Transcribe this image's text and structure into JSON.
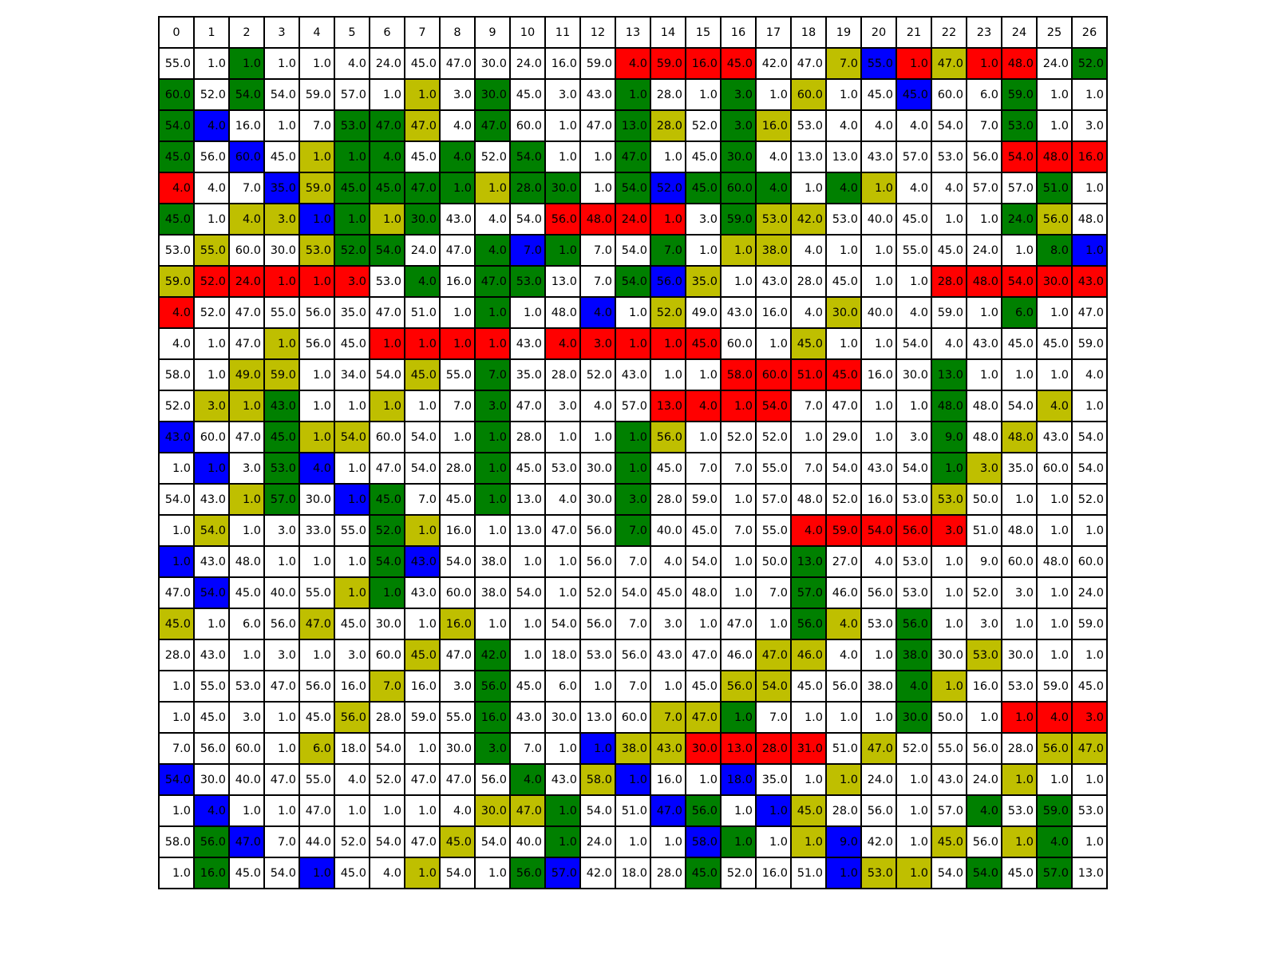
{
  "colors": {
    "w": "#ffffff",
    "g": "#008000",
    "y": "#bfbf00",
    "r": "#ff0000",
    "b": "#0000ff",
    "border": "#000000"
  },
  "headers": [
    "0",
    "1",
    "2",
    "3",
    "4",
    "5",
    "6",
    "7",
    "8",
    "9",
    "10",
    "11",
    "12",
    "13",
    "14",
    "15",
    "16",
    "17",
    "18",
    "19",
    "20",
    "21",
    "22",
    "23",
    "24",
    "25",
    "26"
  ],
  "values": [
    [
      "55.0",
      "1.0",
      "1.0",
      "1.0",
      "1.0",
      "4.0",
      "24.0",
      "45.0",
      "47.0",
      "30.0",
      "24.0",
      "16.0",
      "59.0",
      "4.0",
      "59.0",
      "16.0",
      "45.0",
      "42.0",
      "47.0",
      "7.0",
      "55.0",
      "1.0",
      "47.0",
      "1.0",
      "48.0",
      "24.0",
      "52.0"
    ],
    [
      "60.0",
      "52.0",
      "54.0",
      "54.0",
      "59.0",
      "57.0",
      "1.0",
      "1.0",
      "3.0",
      "30.0",
      "45.0",
      "3.0",
      "43.0",
      "1.0",
      "28.0",
      "1.0",
      "3.0",
      "1.0",
      "60.0",
      "1.0",
      "45.0",
      "45.0",
      "60.0",
      "6.0",
      "59.0",
      "1.0",
      "1.0"
    ],
    [
      "54.0",
      "4.0",
      "16.0",
      "1.0",
      "7.0",
      "53.0",
      "47.0",
      "47.0",
      "4.0",
      "47.0",
      "60.0",
      "1.0",
      "47.0",
      "13.0",
      "28.0",
      "52.0",
      "3.0",
      "16.0",
      "53.0",
      "4.0",
      "4.0",
      "4.0",
      "54.0",
      "7.0",
      "53.0",
      "1.0",
      "3.0"
    ],
    [
      "45.0",
      "56.0",
      "60.0",
      "45.0",
      "1.0",
      "1.0",
      "4.0",
      "45.0",
      "4.0",
      "52.0",
      "54.0",
      "1.0",
      "1.0",
      "47.0",
      "1.0",
      "45.0",
      "30.0",
      "4.0",
      "13.0",
      "13.0",
      "43.0",
      "57.0",
      "53.0",
      "56.0",
      "54.0",
      "48.0",
      "16.0"
    ],
    [
      "4.0",
      "4.0",
      "7.0",
      "35.0",
      "59.0",
      "45.0",
      "45.0",
      "47.0",
      "1.0",
      "1.0",
      "28.0",
      "30.0",
      "1.0",
      "54.0",
      "52.0",
      "45.0",
      "60.0",
      "4.0",
      "1.0",
      "4.0",
      "1.0",
      "4.0",
      "4.0",
      "57.0",
      "57.0",
      "51.0",
      "1.0"
    ],
    [
      "45.0",
      "1.0",
      "4.0",
      "3.0",
      "1.0",
      "1.0",
      "1.0",
      "30.0",
      "43.0",
      "4.0",
      "54.0",
      "56.0",
      "48.0",
      "24.0",
      "1.0",
      "3.0",
      "59.0",
      "53.0",
      "42.0",
      "53.0",
      "40.0",
      "45.0",
      "1.0",
      "1.0",
      "24.0",
      "56.0",
      "48.0"
    ],
    [
      "53.0",
      "55.0",
      "60.0",
      "30.0",
      "53.0",
      "52.0",
      "54.0",
      "24.0",
      "47.0",
      "4.0",
      "7.0",
      "1.0",
      "7.0",
      "54.0",
      "7.0",
      "1.0",
      "1.0",
      "38.0",
      "4.0",
      "1.0",
      "1.0",
      "55.0",
      "45.0",
      "24.0",
      "1.0",
      "8.0",
      "1.0"
    ],
    [
      "59.0",
      "52.0",
      "24.0",
      "1.0",
      "1.0",
      "3.0",
      "53.0",
      "4.0",
      "16.0",
      "47.0",
      "53.0",
      "13.0",
      "7.0",
      "54.0",
      "56.0",
      "35.0",
      "1.0",
      "43.0",
      "28.0",
      "45.0",
      "1.0",
      "1.0",
      "28.0",
      "48.0",
      "54.0",
      "30.0",
      "43.0"
    ],
    [
      "4.0",
      "52.0",
      "47.0",
      "55.0",
      "56.0",
      "35.0",
      "47.0",
      "51.0",
      "1.0",
      "1.0",
      "1.0",
      "48.0",
      "4.0",
      "1.0",
      "52.0",
      "49.0",
      "43.0",
      "16.0",
      "4.0",
      "30.0",
      "40.0",
      "4.0",
      "59.0",
      "1.0",
      "6.0",
      "1.0",
      "47.0"
    ],
    [
      "4.0",
      "1.0",
      "47.0",
      "1.0",
      "56.0",
      "45.0",
      "1.0",
      "1.0",
      "1.0",
      "1.0",
      "43.0",
      "4.0",
      "3.0",
      "1.0",
      "1.0",
      "45.0",
      "60.0",
      "1.0",
      "45.0",
      "1.0",
      "1.0",
      "54.0",
      "4.0",
      "43.0",
      "45.0",
      "45.0",
      "59.0"
    ],
    [
      "58.0",
      "1.0",
      "49.0",
      "59.0",
      "1.0",
      "34.0",
      "54.0",
      "45.0",
      "55.0",
      "7.0",
      "35.0",
      "28.0",
      "52.0",
      "43.0",
      "1.0",
      "1.0",
      "58.0",
      "60.0",
      "51.0",
      "45.0",
      "16.0",
      "30.0",
      "13.0",
      "1.0",
      "1.0",
      "1.0",
      "4.0"
    ],
    [
      "52.0",
      "3.0",
      "1.0",
      "43.0",
      "1.0",
      "1.0",
      "1.0",
      "1.0",
      "7.0",
      "3.0",
      "47.0",
      "3.0",
      "4.0",
      "57.0",
      "13.0",
      "4.0",
      "1.0",
      "54.0",
      "7.0",
      "47.0",
      "1.0",
      "1.0",
      "48.0",
      "48.0",
      "54.0",
      "4.0",
      "1.0"
    ],
    [
      "43.0",
      "60.0",
      "47.0",
      "45.0",
      "1.0",
      "54.0",
      "60.0",
      "54.0",
      "1.0",
      "1.0",
      "28.0",
      "1.0",
      "1.0",
      "1.0",
      "56.0",
      "1.0",
      "52.0",
      "52.0",
      "1.0",
      "29.0",
      "1.0",
      "3.0",
      "9.0",
      "48.0",
      "48.0",
      "43.0",
      "54.0"
    ],
    [
      "1.0",
      "1.0",
      "3.0",
      "53.0",
      "4.0",
      "1.0",
      "47.0",
      "54.0",
      "28.0",
      "1.0",
      "45.0",
      "53.0",
      "30.0",
      "1.0",
      "45.0",
      "7.0",
      "7.0",
      "55.0",
      "7.0",
      "54.0",
      "43.0",
      "54.0",
      "1.0",
      "3.0",
      "35.0",
      "60.0",
      "54.0"
    ],
    [
      "54.0",
      "43.0",
      "1.0",
      "57.0",
      "30.0",
      "1.0",
      "45.0",
      "7.0",
      "45.0",
      "1.0",
      "13.0",
      "4.0",
      "30.0",
      "3.0",
      "28.0",
      "59.0",
      "1.0",
      "57.0",
      "48.0",
      "52.0",
      "16.0",
      "53.0",
      "53.0",
      "50.0",
      "1.0",
      "1.0",
      "52.0"
    ],
    [
      "1.0",
      "54.0",
      "1.0",
      "3.0",
      "33.0",
      "55.0",
      "52.0",
      "1.0",
      "16.0",
      "1.0",
      "13.0",
      "47.0",
      "56.0",
      "7.0",
      "40.0",
      "45.0",
      "7.0",
      "55.0",
      "4.0",
      "59.0",
      "54.0",
      "56.0",
      "3.0",
      "51.0",
      "48.0",
      "1.0",
      "1.0"
    ],
    [
      "1.0",
      "43.0",
      "48.0",
      "1.0",
      "1.0",
      "1.0",
      "54.0",
      "43.0",
      "54.0",
      "38.0",
      "1.0",
      "1.0",
      "56.0",
      "7.0",
      "4.0",
      "54.0",
      "1.0",
      "50.0",
      "13.0",
      "27.0",
      "4.0",
      "53.0",
      "1.0",
      "9.0",
      "60.0",
      "48.0",
      "60.0"
    ],
    [
      "47.0",
      "54.0",
      "45.0",
      "40.0",
      "55.0",
      "1.0",
      "1.0",
      "43.0",
      "60.0",
      "38.0",
      "54.0",
      "1.0",
      "52.0",
      "54.0",
      "45.0",
      "48.0",
      "1.0",
      "7.0",
      "57.0",
      "46.0",
      "56.0",
      "53.0",
      "1.0",
      "52.0",
      "3.0",
      "1.0",
      "24.0"
    ],
    [
      "45.0",
      "1.0",
      "6.0",
      "56.0",
      "47.0",
      "45.0",
      "30.0",
      "1.0",
      "16.0",
      "1.0",
      "1.0",
      "54.0",
      "56.0",
      "7.0",
      "3.0",
      "1.0",
      "47.0",
      "1.0",
      "56.0",
      "4.0",
      "53.0",
      "56.0",
      "1.0",
      "3.0",
      "1.0",
      "1.0",
      "59.0"
    ],
    [
      "28.0",
      "43.0",
      "1.0",
      "3.0",
      "1.0",
      "3.0",
      "60.0",
      "45.0",
      "47.0",
      "42.0",
      "1.0",
      "18.0",
      "53.0",
      "56.0",
      "43.0",
      "47.0",
      "46.0",
      "47.0",
      "46.0",
      "4.0",
      "1.0",
      "38.0",
      "30.0",
      "53.0",
      "30.0",
      "1.0",
      "1.0"
    ],
    [
      "1.0",
      "55.0",
      "53.0",
      "47.0",
      "56.0",
      "16.0",
      "7.0",
      "16.0",
      "3.0",
      "56.0",
      "45.0",
      "6.0",
      "1.0",
      "7.0",
      "1.0",
      "45.0",
      "56.0",
      "54.0",
      "45.0",
      "56.0",
      "38.0",
      "4.0",
      "1.0",
      "16.0",
      "53.0",
      "59.0",
      "45.0"
    ],
    [
      "1.0",
      "45.0",
      "3.0",
      "1.0",
      "45.0",
      "56.0",
      "28.0",
      "59.0",
      "55.0",
      "16.0",
      "43.0",
      "30.0",
      "13.0",
      "60.0",
      "7.0",
      "47.0",
      "1.0",
      "7.0",
      "1.0",
      "1.0",
      "1.0",
      "30.0",
      "50.0",
      "1.0",
      "1.0",
      "4.0",
      "3.0"
    ],
    [
      "7.0",
      "56.0",
      "60.0",
      "1.0",
      "6.0",
      "18.0",
      "54.0",
      "1.0",
      "30.0",
      "3.0",
      "7.0",
      "1.0",
      "1.0",
      "38.0",
      "43.0",
      "30.0",
      "13.0",
      "28.0",
      "31.0",
      "51.0",
      "47.0",
      "52.0",
      "55.0",
      "56.0",
      "28.0",
      "56.0",
      "47.0"
    ],
    [
      "54.0",
      "30.0",
      "40.0",
      "47.0",
      "55.0",
      "4.0",
      "52.0",
      "47.0",
      "47.0",
      "56.0",
      "4.0",
      "43.0",
      "58.0",
      "1.0",
      "16.0",
      "1.0",
      "18.0",
      "35.0",
      "1.0",
      "1.0",
      "24.0",
      "1.0",
      "43.0",
      "24.0",
      "1.0",
      "1.0",
      "1.0"
    ],
    [
      "1.0",
      "4.0",
      "1.0",
      "1.0",
      "47.0",
      "1.0",
      "1.0",
      "1.0",
      "4.0",
      "30.0",
      "47.0",
      "1.0",
      "54.0",
      "51.0",
      "47.0",
      "56.0",
      "1.0",
      "1.0",
      "45.0",
      "28.0",
      "56.0",
      "1.0",
      "57.0",
      "4.0",
      "53.0",
      "59.0",
      "53.0"
    ],
    [
      "58.0",
      "56.0",
      "47.0",
      "7.0",
      "44.0",
      "52.0",
      "54.0",
      "47.0",
      "45.0",
      "54.0",
      "40.0",
      "1.0",
      "24.0",
      "1.0",
      "1.0",
      "58.0",
      "1.0",
      "1.0",
      "1.0",
      "9.0",
      "42.0",
      "1.0",
      "45.0",
      "56.0",
      "1.0",
      "4.0",
      "1.0"
    ],
    [
      "1.0",
      "16.0",
      "45.0",
      "54.0",
      "1.0",
      "45.0",
      "4.0",
      "1.0",
      "54.0",
      "1.0",
      "56.0",
      "57.0",
      "42.0",
      "18.0",
      "28.0",
      "45.0",
      "52.0",
      "16.0",
      "51.0",
      "1.0",
      "53.0",
      "1.0",
      "54.0",
      "54.0",
      "45.0",
      "57.0",
      "13.0"
    ]
  ],
  "fills": [
    "wwgwwwwwwwwwwrrrrwwybryrrwg",
    "gwgwwwwywgwwwgwwgwywwbwwgww",
    "gbwwwggywgwwwgywgywwwwwwgww",
    "gwbwyggwgwgwwgwwgwwwwwwwrrr",
    "rwwbyggggyggwgbgggwgywwwwgwy",
    "gwyybgygwwwrrrrwgyywwwwwgyw",
    "wywwyggwwgbgwwgwyywwwwwwwgbw",
    "yrrrrrwgwggwwgbywwwwwwrrrrr",
    "rwwwwwwwwgwwbwywwwwywwwwgww",
    "wwwywwrrrrwrrrrrwwywwwwwwww",
    "wwyywwwywgwwwwwwrrrrwwgwwww",
    "wyygwwywwgwwwwrrrrwwwwgwwyw",
    "bwwgyywwwgwwwgywwwwwwwgwywww",
    "wbwgbwwwwgwwwgwwwwwwwwgywww",
    "wwygwbgwwgwwwgwwwwwwwwywwww",
    "wywwwwgywwwwwgwwwwrrrrrwwww",
    "bwwwwwgbwwwwwwwwwwgwwwwwwww",
    "wbwwwygwwwwwwwwwwwgwwwwwwww",
    "ywwwywwwywwwwwwwwwgywgwwwww",
    "wwwwwwwywgwwwwwwwyywwgwywww",
    "wwwwwwywwgwwwwwwyywwwgywwww",
    "wwwwwywwwgwwwwyygwwwwgwwrrrr",
    "wwwwywwwwgwwbyyrrrrwywwwwyy",
    "bwwwwwwwwwgwybwwbwwywwwwyww",
    "wbwwwwwwwyygwwbgwbywwwwgwgw",
    "wgbwwwwwywwgwwwbgwybwwywygwgw",
    "wgwwbwwywwgbwwwgwwwbyywgwgw"
  ]
}
